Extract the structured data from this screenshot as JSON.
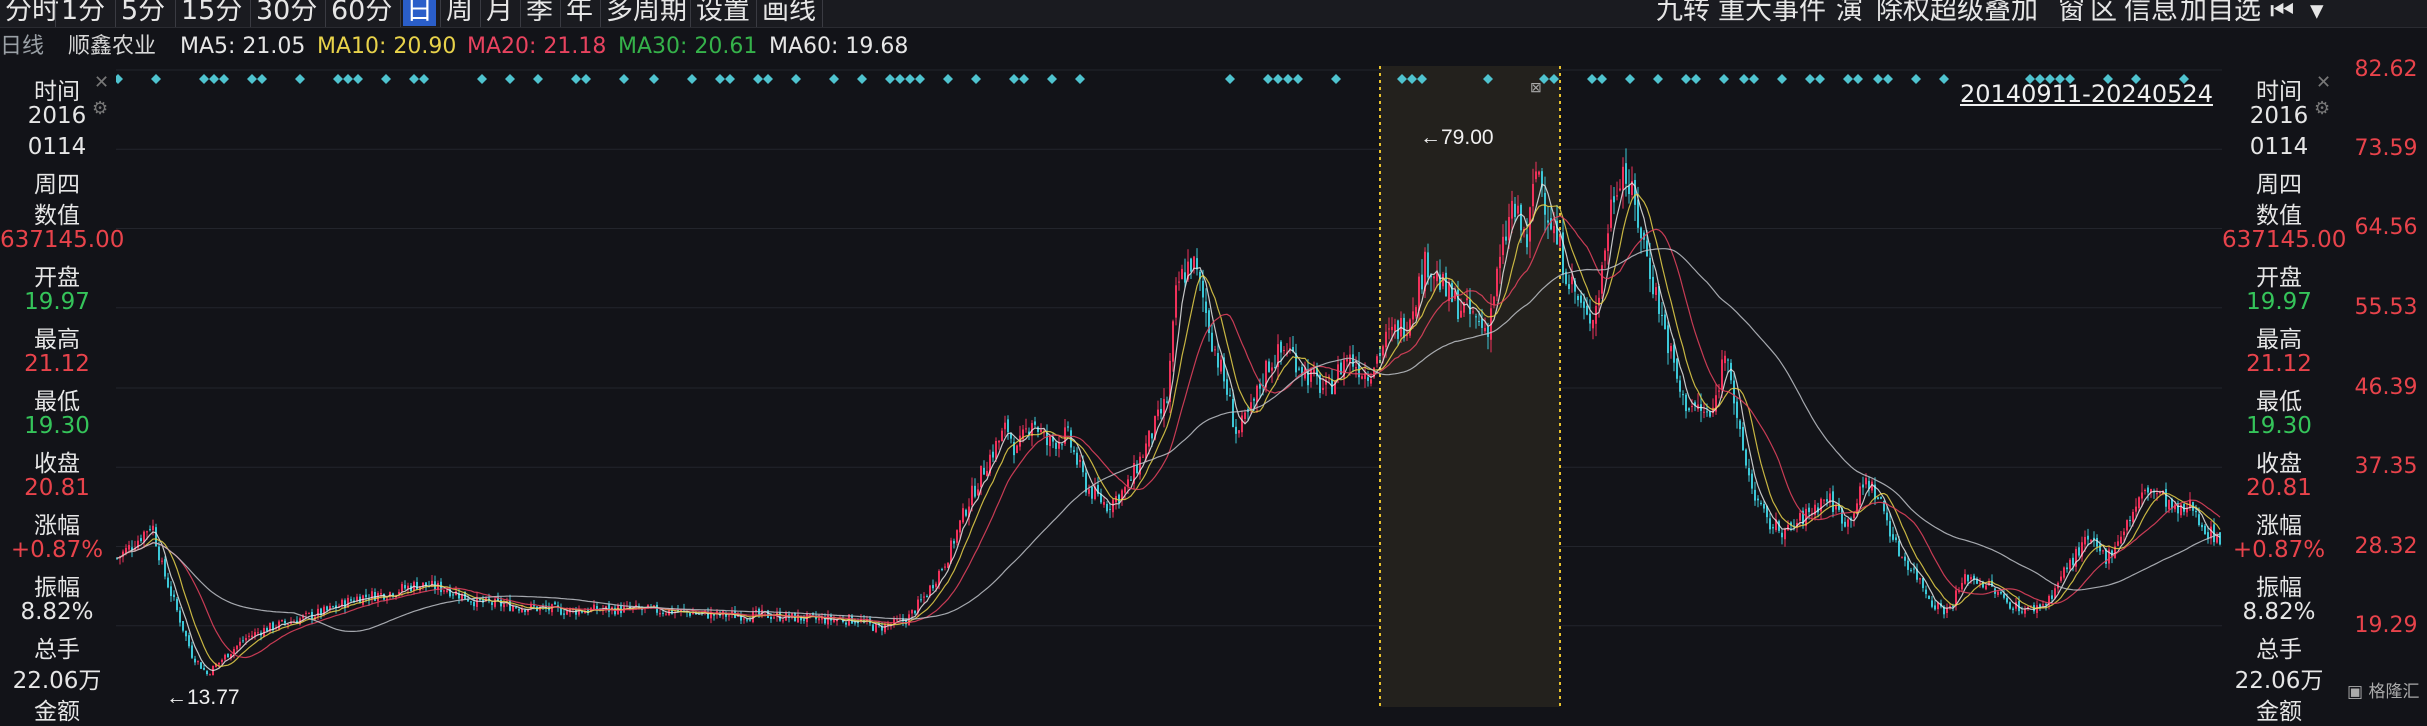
{
  "toolbar": {
    "periods": [
      "分时",
      "1分",
      "5分",
      "15分",
      "30分",
      "60分",
      "日",
      "周",
      "月",
      "季",
      "年",
      "多周期",
      "设置",
      "画线"
    ],
    "active_period": "日",
    "right_tools": [
      "九转",
      "重大事件",
      "演",
      "除权",
      "超级叠加",
      "窗",
      "区",
      "信息",
      "加自选"
    ],
    "icons": [
      "step-back-icon",
      "dropdown-arrow-icon"
    ]
  },
  "ma_bar": {
    "period_label": "日线",
    "stock_name": "顺鑫农业",
    "ma5": "MA5: 21.05",
    "ma10": "MA10: 20.90",
    "ma20": "MA20: 21.18",
    "ma30": "MA30: 20.61",
    "ma60": "MA60: 19.68",
    "colors": {
      "ma5": "#e6e6e6",
      "ma10": "#e8d24a",
      "ma20": "#e8435f",
      "ma30": "#35b24a",
      "ma60": "#e6e6e6"
    }
  },
  "info_panel": {
    "time_label": "时间",
    "year": "2016",
    "date": "0114",
    "weekday": "周四",
    "value_label": "数值",
    "value": "637145.00",
    "open_label": "开盘",
    "open": "19.97",
    "high_label": "最高",
    "high": "21.12",
    "low_label": "最低",
    "low": "19.30",
    "close_label": "收盘",
    "close": "20.81",
    "change_label": "涨幅",
    "change": "+0.87%",
    "amplitude_label": "振幅",
    "amplitude": "8.82%",
    "volume_label": "总手",
    "volume": "22.06万",
    "amount_label": "金额"
  },
  "date_range": "20140911-20240524",
  "chart_data": {
    "type": "candlestick",
    "price_axis_labels": [
      "82.62",
      "73.59",
      "64.56",
      "55.53",
      "46.39",
      "37.35",
      "28.32",
      "19.29"
    ],
    "ylim": [
      13.0,
      82.62
    ],
    "annotations": {
      "max_label": "79.00",
      "min_label": "13.77"
    },
    "trend_points": [
      [
        0,
        27
      ],
      [
        20,
        29
      ],
      [
        35,
        31
      ],
      [
        45,
        26
      ],
      [
        60,
        21
      ],
      [
        75,
        16
      ],
      [
        90,
        13.8
      ],
      [
        110,
        16
      ],
      [
        130,
        18
      ],
      [
        150,
        19
      ],
      [
        180,
        20
      ],
      [
        210,
        21
      ],
      [
        240,
        22.5
      ],
      [
        270,
        23
      ],
      [
        300,
        24
      ],
      [
        330,
        23.5
      ],
      [
        360,
        22
      ],
      [
        400,
        21.5
      ],
      [
        450,
        21
      ],
      [
        500,
        21.2
      ],
      [
        550,
        21
      ],
      [
        600,
        20.5
      ],
      [
        650,
        20.5
      ],
      [
        700,
        20
      ],
      [
        740,
        20
      ],
      [
        760,
        19
      ],
      [
        790,
        20
      ],
      [
        810,
        23
      ],
      [
        830,
        27
      ],
      [
        850,
        33
      ],
      [
        870,
        38
      ],
      [
        890,
        42
      ],
      [
        900,
        39
      ],
      [
        915,
        43
      ],
      [
        930,
        40
      ],
      [
        950,
        41
      ],
      [
        970,
        35
      ],
      [
        990,
        33
      ],
      [
        1010,
        35
      ],
      [
        1030,
        40
      ],
      [
        1050,
        45
      ],
      [
        1060,
        58
      ],
      [
        1075,
        61
      ],
      [
        1085,
        57
      ],
      [
        1095,
        52
      ],
      [
        1110,
        46
      ],
      [
        1120,
        41
      ],
      [
        1135,
        44
      ],
      [
        1150,
        49
      ],
      [
        1170,
        51
      ],
      [
        1190,
        48
      ],
      [
        1210,
        46
      ],
      [
        1230,
        50
      ],
      [
        1250,
        48
      ],
      [
        1270,
        52
      ],
      [
        1290,
        54
      ],
      [
        1310,
        61
      ],
      [
        1330,
        57
      ],
      [
        1350,
        55
      ],
      [
        1370,
        53
      ],
      [
        1380,
        59
      ],
      [
        1395,
        67
      ],
      [
        1410,
        63
      ],
      [
        1420,
        72
      ],
      [
        1430,
        67
      ],
      [
        1440,
        63
      ],
      [
        1455,
        58
      ],
      [
        1470,
        54
      ],
      [
        1480,
        56
      ],
      [
        1495,
        68
      ],
      [
        1505,
        72
      ],
      [
        1520,
        66
      ],
      [
        1535,
        59
      ],
      [
        1550,
        52
      ],
      [
        1565,
        45
      ],
      [
        1580,
        44
      ],
      [
        1595,
        43
      ],
      [
        1610,
        52
      ],
      [
        1620,
        42
      ],
      [
        1635,
        35
      ],
      [
        1650,
        31
      ],
      [
        1670,
        30
      ],
      [
        1690,
        32
      ],
      [
        1710,
        34
      ],
      [
        1730,
        31
      ],
      [
        1750,
        36
      ],
      [
        1765,
        33
      ],
      [
        1780,
        28
      ],
      [
        1800,
        25
      ],
      [
        1815,
        22
      ],
      [
        1830,
        21
      ],
      [
        1850,
        25
      ],
      [
        1870,
        24
      ],
      [
        1890,
        22
      ],
      [
        1910,
        21
      ],
      [
        1930,
        22
      ],
      [
        1950,
        26
      ],
      [
        1970,
        29
      ],
      [
        1990,
        27
      ],
      [
        2010,
        31
      ],
      [
        2030,
        35
      ],
      [
        2045,
        34
      ],
      [
        2060,
        32
      ],
      [
        2075,
        33
      ],
      [
        2090,
        30
      ],
      [
        2110,
        29
      ],
      [
        2130,
        27
      ],
      [
        2150,
        25
      ],
      [
        2170,
        24
      ],
      [
        2190,
        22
      ],
      [
        2205,
        23
      ]
    ],
    "marker_color": "#4fc3cf",
    "up_color": "#f0315a",
    "down_color": "#3cc8d8"
  },
  "watermark": "格隆汇"
}
